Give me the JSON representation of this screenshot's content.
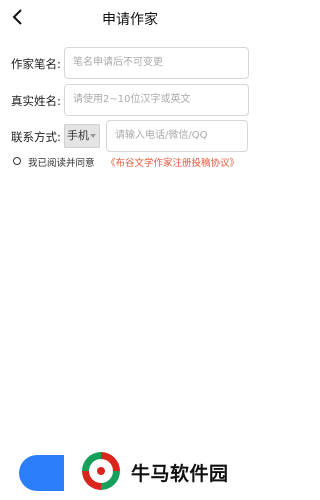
{
  "header": {
    "title": "申请作家"
  },
  "form": {
    "pen_name": {
      "label": "作家笔名:",
      "placeholder": "笔名申请后不可变更"
    },
    "real_name": {
      "label": "真实姓名:",
      "placeholder": "请使用2~10位汉字或英文"
    },
    "contact": {
      "label": "联系方式:",
      "method": "手机",
      "placeholder": "请输入电话/微信/QQ"
    }
  },
  "agreement": {
    "text": "我已阅读并同意",
    "link": "《布谷文学作家注册投稿协议》"
  },
  "watermark": {
    "text": "牛马软件园"
  },
  "colors": {
    "accent": "#2c7ef8",
    "link": "#e55a3c",
    "logo_red": "#d9251c",
    "logo_green": "#16a05a"
  }
}
